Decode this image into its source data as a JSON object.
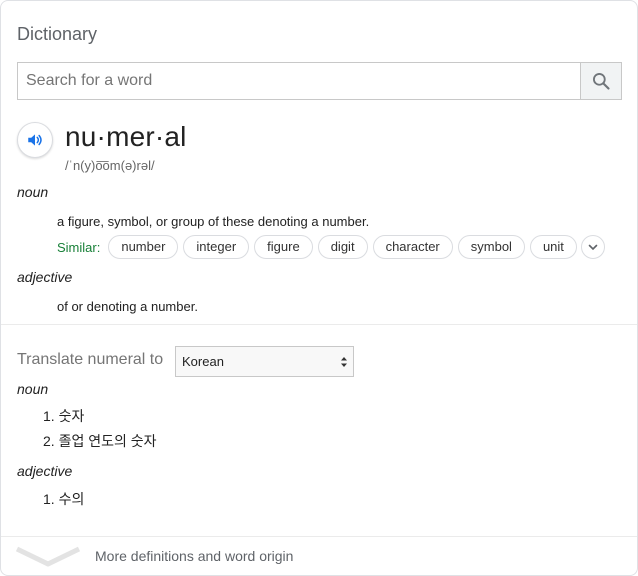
{
  "header": {
    "title": "Dictionary"
  },
  "search": {
    "placeholder": "Search for a word"
  },
  "entry": {
    "headword": "nu·mer·al",
    "phonetic": "/ˈn(y)o͞om(ə)rəl/",
    "senses": [
      {
        "pos": "noun",
        "definition": "a figure, symbol, or group of these denoting a number.",
        "similar_label": "Similar:",
        "similar": [
          "number",
          "integer",
          "figure",
          "digit",
          "character",
          "symbol",
          "unit"
        ]
      },
      {
        "pos": "adjective",
        "definition": "of or denoting a number."
      }
    ]
  },
  "translate": {
    "label": "Translate numeral to",
    "language": "Korean",
    "groups": [
      {
        "pos": "noun",
        "items": [
          "1. 숫자",
          "2. 졸업 연도의 숫자"
        ]
      },
      {
        "pos": "adjective",
        "items": [
          "1. 수의"
        ]
      }
    ]
  },
  "footer": {
    "more_label": "More definitions and word origin"
  },
  "colors": {
    "accent": "#1a73e8",
    "similar_green": "#188038",
    "muted": "#5f6368"
  },
  "icons": {
    "search": "search-icon",
    "speaker": "speaker-icon",
    "expand": "chevron-down-icon",
    "select": "select-arrows-icon"
  }
}
